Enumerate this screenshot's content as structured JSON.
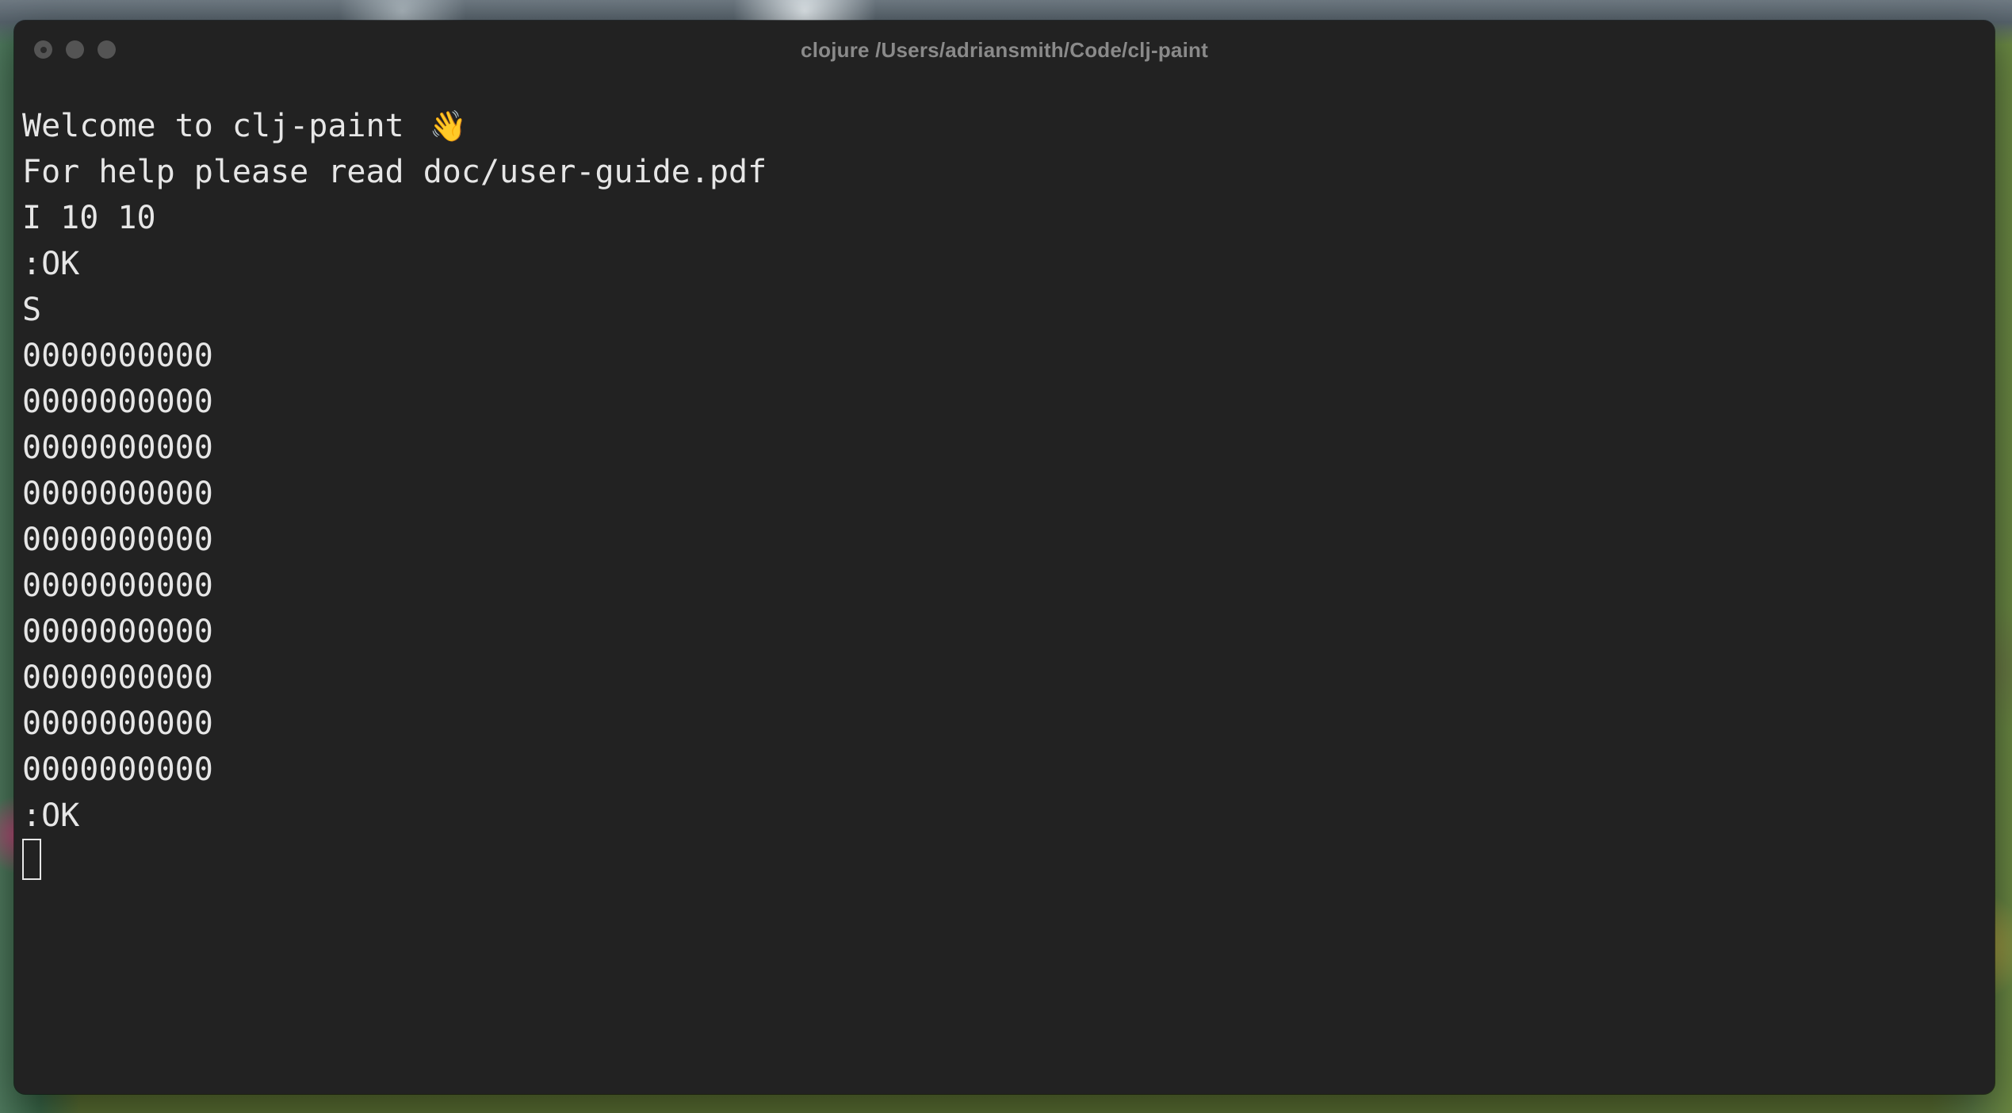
{
  "window": {
    "title": "clojure /Users/adriansmith/Code/clj-paint"
  },
  "terminal": {
    "welcome_text": "Welcome to clj-paint ",
    "welcome_icon": "👋",
    "help_line": "For help please read doc/user-guide.pdf",
    "cmd_init": "I 10 10",
    "ok_1": ":OK",
    "cmd_show": "S",
    "canvas_rows": [
      "0000000000",
      "0000000000",
      "0000000000",
      "0000000000",
      "0000000000",
      "0000000000",
      "0000000000",
      "0000000000",
      "0000000000",
      "0000000000"
    ],
    "ok_2": ":OK"
  },
  "colors": {
    "terminal_bg": "#222222",
    "terminal_text": "#e6e6e6",
    "title_text": "#8a8a8a",
    "traffic_light": "#545454"
  },
  "icons": {
    "welcome": "waving-hand-icon",
    "close": "close-icon",
    "minimize": "minimize-icon",
    "maximize": "maximize-icon"
  }
}
